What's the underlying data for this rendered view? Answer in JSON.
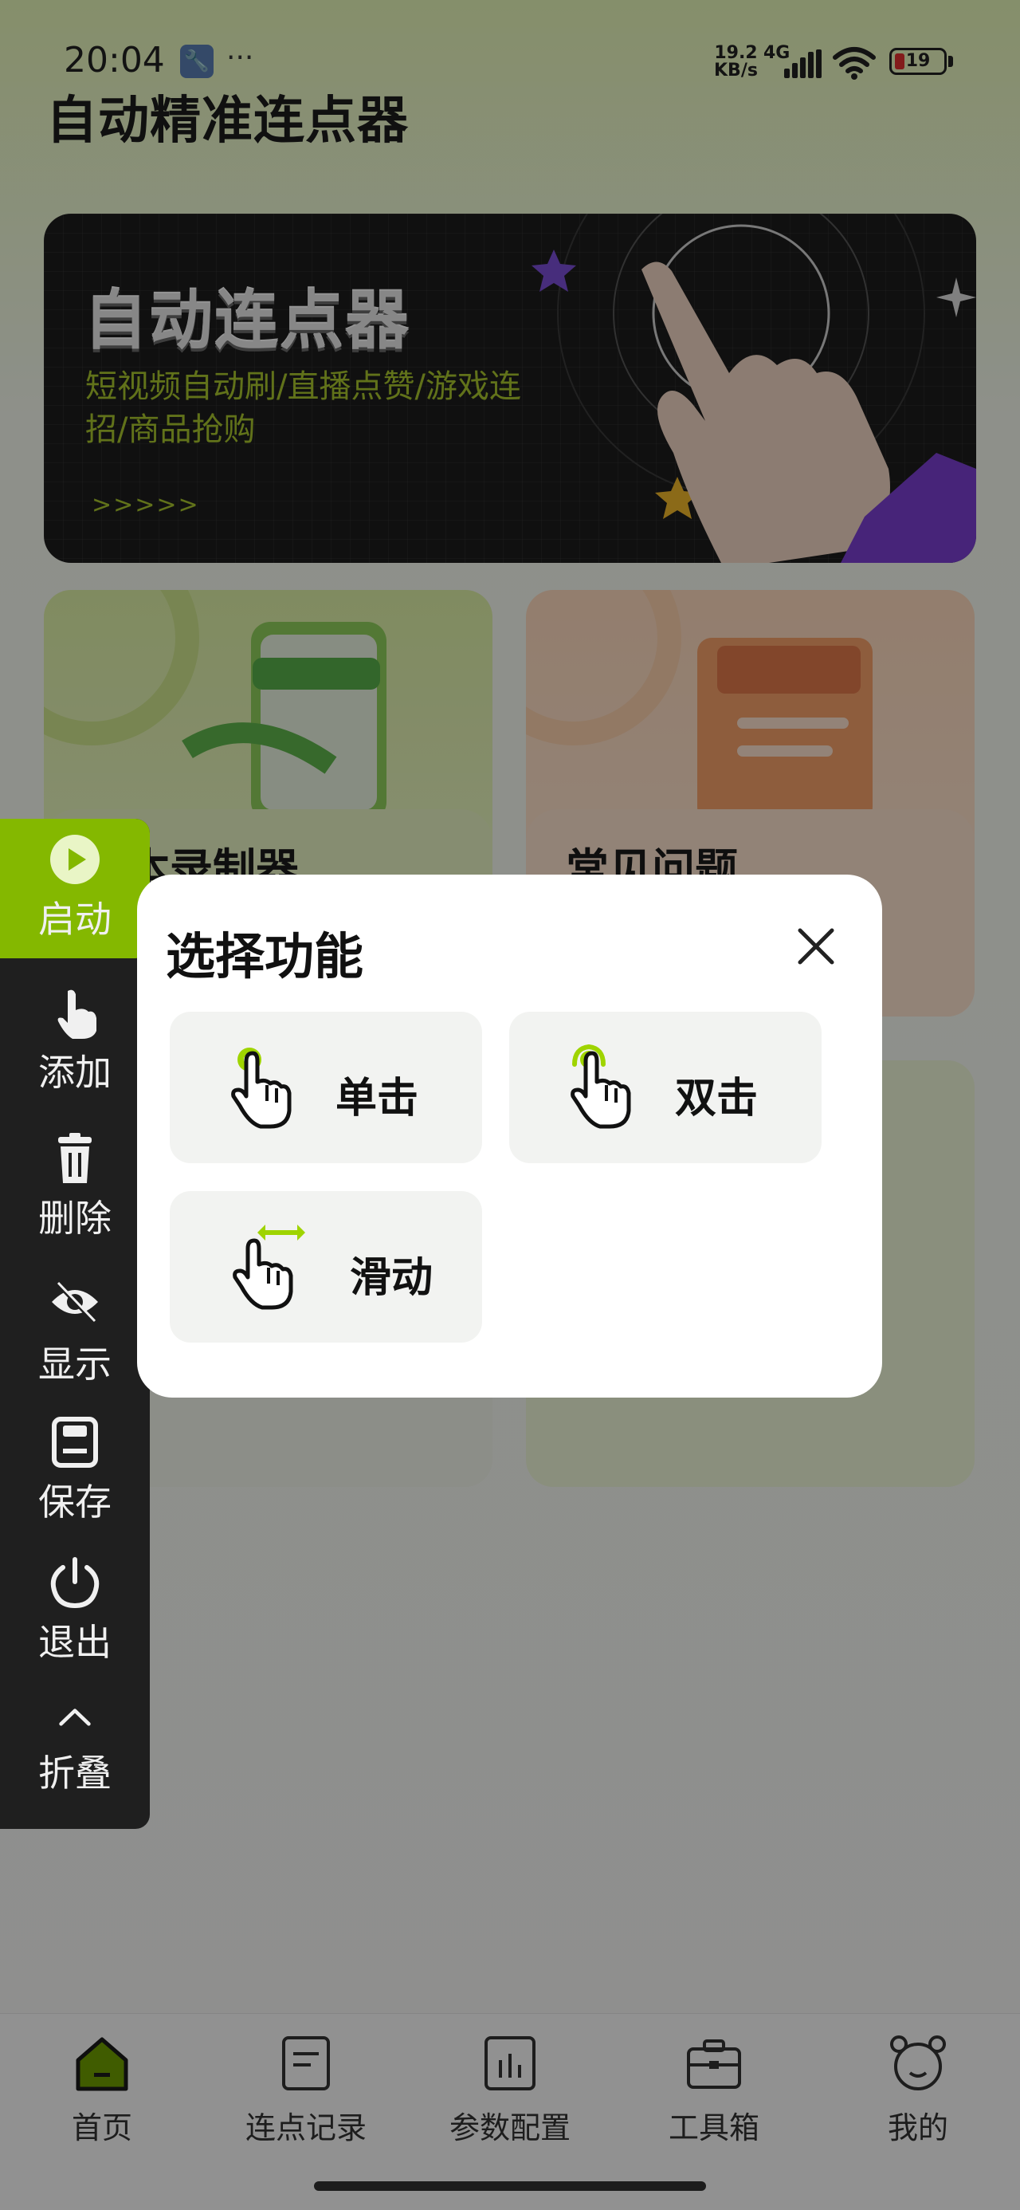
{
  "status_bar": {
    "time": "20:04",
    "dots": "···",
    "net_speed": "19.2",
    "net_speed_unit": "KB/s",
    "network": "4G",
    "battery": "19",
    "battery_color": "#e03030"
  },
  "app": {
    "title": "自动精准连点器",
    "accent": "#84b800"
  },
  "banner": {
    "title": "自动连点器",
    "subtitle": "短视频自动刷/直播点赞/游戏连招/商品抢购",
    "arrows": ">>>>>"
  },
  "cards": {
    "green_title": "脚本录制器",
    "orange_title": "常见问题"
  },
  "sidebar": {
    "items": [
      {
        "label": "启动",
        "icon": "play-icon"
      },
      {
        "label": "添加",
        "icon": "hand-pointer-icon"
      },
      {
        "label": "删除",
        "icon": "trash-icon"
      },
      {
        "label": "显示",
        "icon": "eye-off-icon"
      },
      {
        "label": "保存",
        "icon": "save-icon"
      },
      {
        "label": "退出",
        "icon": "power-icon"
      },
      {
        "label": "折叠",
        "icon": "chevron-up-icon"
      }
    ]
  },
  "dialog": {
    "title": "选择功能",
    "options": [
      {
        "label": "单击",
        "icon": "single-tap-icon"
      },
      {
        "label": "双击",
        "icon": "double-tap-icon"
      },
      {
        "label": "滑动",
        "icon": "swipe-icon"
      }
    ]
  },
  "tabbar": {
    "items": [
      {
        "label": "首页",
        "icon": "home-icon",
        "active": true
      },
      {
        "label": "连点记录",
        "icon": "record-icon"
      },
      {
        "label": "参数配置",
        "icon": "chart-config-icon"
      },
      {
        "label": "工具箱",
        "icon": "toolbox-icon"
      },
      {
        "label": "我的",
        "icon": "profile-icon"
      }
    ]
  }
}
